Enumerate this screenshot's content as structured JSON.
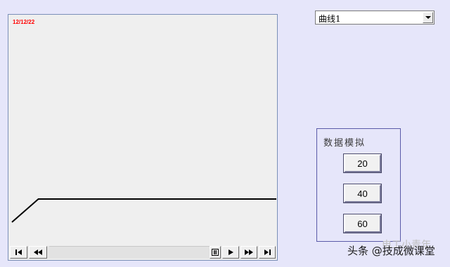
{
  "trend": {
    "date": "12/12/22",
    "curve_points": [
      {
        "x": 0,
        "y": 0
      },
      {
        "x": 0.1,
        "y": 0.3
      },
      {
        "x": 1,
        "y": 0.3
      }
    ]
  },
  "curve_select": {
    "selected": "曲线1"
  },
  "simulation": {
    "title": "数据模拟",
    "buttons": [
      "20",
      "40",
      "60"
    ]
  },
  "watermark": {
    "text": "头条 @技成微课堂",
    "faint_text": "电工小青年"
  },
  "icons": {
    "toolbar": [
      "skip-to-start-icon",
      "rewind-icon",
      "pause-icon",
      "play-icon",
      "fast-forward-icon",
      "skip-to-end-icon"
    ],
    "dropdown": "chevron-down-icon"
  }
}
